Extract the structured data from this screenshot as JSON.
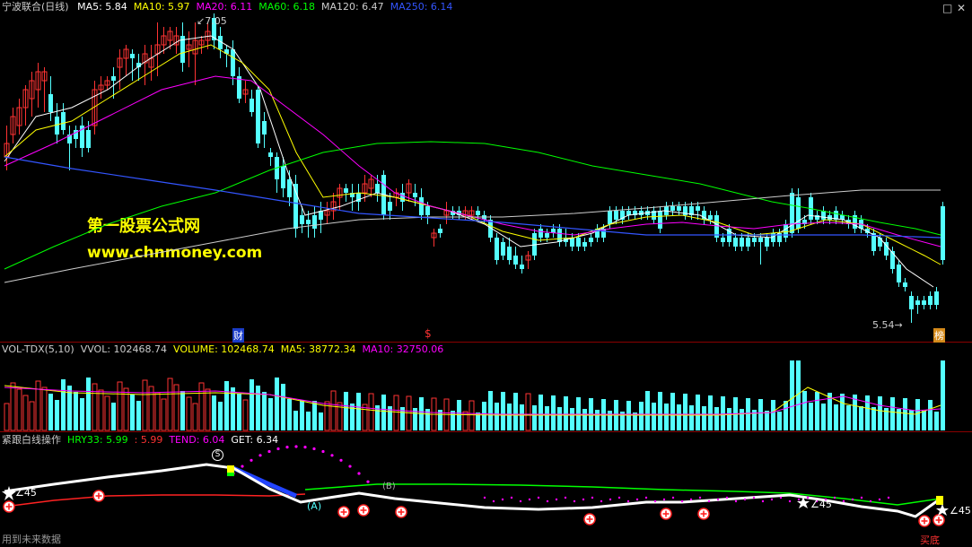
{
  "main_panel": {
    "stock_name": "宁波联合(日线)",
    "ma_labels": [
      {
        "text": "MA5: 5.84",
        "color": "#ffffff"
      },
      {
        "text": "MA10: 5.97",
        "color": "#ffff00"
      },
      {
        "text": "MA20: 6.11",
        "color": "#ff00ff"
      },
      {
        "text": "MA60: 6.18",
        "color": "#00ff00"
      },
      {
        "text": "MA120: 6.47",
        "color": "#cccccc"
      },
      {
        "text": "MA250: 6.14",
        "color": "#3355ff"
      }
    ],
    "high_annotation": "7.05",
    "low_annotation": "5.54",
    "markers": {
      "finance": "财",
      "dollar": "$",
      "rank": "榜"
    }
  },
  "watermark": {
    "line1": "第一股票公式网",
    "line2": "www.chnmoney.com"
  },
  "volume_panel": {
    "labels": [
      {
        "text": "VOL-TDX(5,10)",
        "color": "#cccccc"
      },
      {
        "text": "VVOL: 102468.74",
        "color": "#cccccc"
      },
      {
        "text": "VOLUME: 102468.74",
        "color": "#ffff00"
      },
      {
        "text": "MA5: 38772.34",
        "color": "#ffff00"
      },
      {
        "text": "MA10: 32750.06",
        "color": "#ff00ff"
      }
    ]
  },
  "indicator_panel": {
    "labels": [
      {
        "text": "紧跟白线操作",
        "color": "#cccccc"
      },
      {
        "text": "HRY33: 5.99",
        "color": "#00ff00"
      },
      {
        "text": ": 5.99",
        "color": "#ff3333"
      },
      {
        "text": "TEND: 6.04",
        "color": "#ff00ff"
      },
      {
        "text": "GET: 6.34",
        "color": "#ffffff"
      }
    ],
    "marks": {
      "angle_left": "∠45",
      "angle_mid": "∠45",
      "angle_right": "∠45",
      "a_label": "(A)",
      "b_label": "(B)",
      "s_label": "S"
    },
    "bottom_left": "用到未来数据",
    "bottom_right": "买底"
  },
  "colors": {
    "up": "#ff3333",
    "down": "#54ffff",
    "panel_border": "#8b0000"
  }
}
